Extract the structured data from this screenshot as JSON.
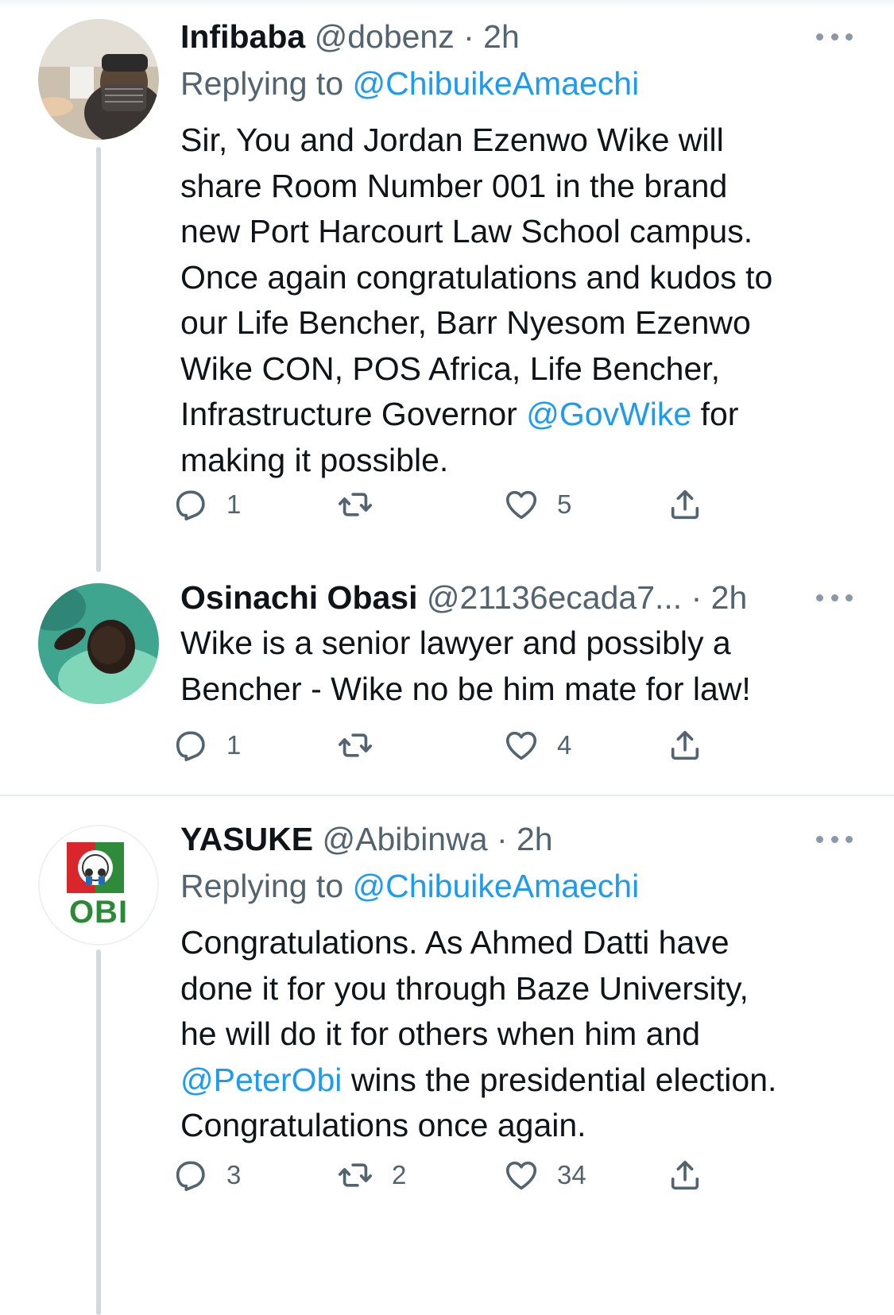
{
  "tweets": [
    {
      "name": "Infibaba",
      "handle": "@dobenz",
      "time": "· 2h",
      "replying_label": "Replying to",
      "replying_to": "@ChibuikeAmaechi",
      "lines": [
        "Sir, You and Jordan Ezenwo Wike will",
        "share Room Number 001 in the brand",
        "new Port Harcourt Law School campus.",
        "Once again congratulations and kudos to",
        "our Life Bencher, Barr Nyesom Ezenwo",
        "Wike CON, POS Africa, Life Bencher,",
        "Infrastructure Governor ",
        "@GovWike",
        " for",
        "making it possible."
      ],
      "replies": "1",
      "retweets": "",
      "likes": "5",
      "icons": {
        "reply": "reply-icon",
        "retweet": "retweet-icon",
        "like": "heart-icon",
        "share": "share-icon",
        "more": "more-icon"
      }
    },
    {
      "name": "Osinachi Obasi",
      "handle": "@21136ecada7...",
      "time": "· 2h",
      "lines": [
        "Wike is a senior lawyer and possibly a",
        "Bencher - Wike no be him mate for law!"
      ],
      "replies": "1",
      "retweets": "",
      "likes": "4"
    },
    {
      "name": "YASUKE",
      "handle": "@Abibinwa",
      "time": "· 2h",
      "replying_label": "Replying to",
      "replying_to": "@ChibuikeAmaechi",
      "avatar_text": "OBI",
      "lines": [
        "Congratulations. As Ahmed Datti have",
        "done it for you through Baze University,",
        "he will do it for others when him and",
        "@PeterObi",
        " wins the presidential election.",
        "Congratulations once again."
      ],
      "replies": "3",
      "retweets": "2",
      "likes": "34"
    }
  ],
  "colors": {
    "link": "#1d9bf0",
    "secondary_text": "#536471",
    "primary_text": "#0f1419",
    "thread_line": "#cfd9de"
  }
}
